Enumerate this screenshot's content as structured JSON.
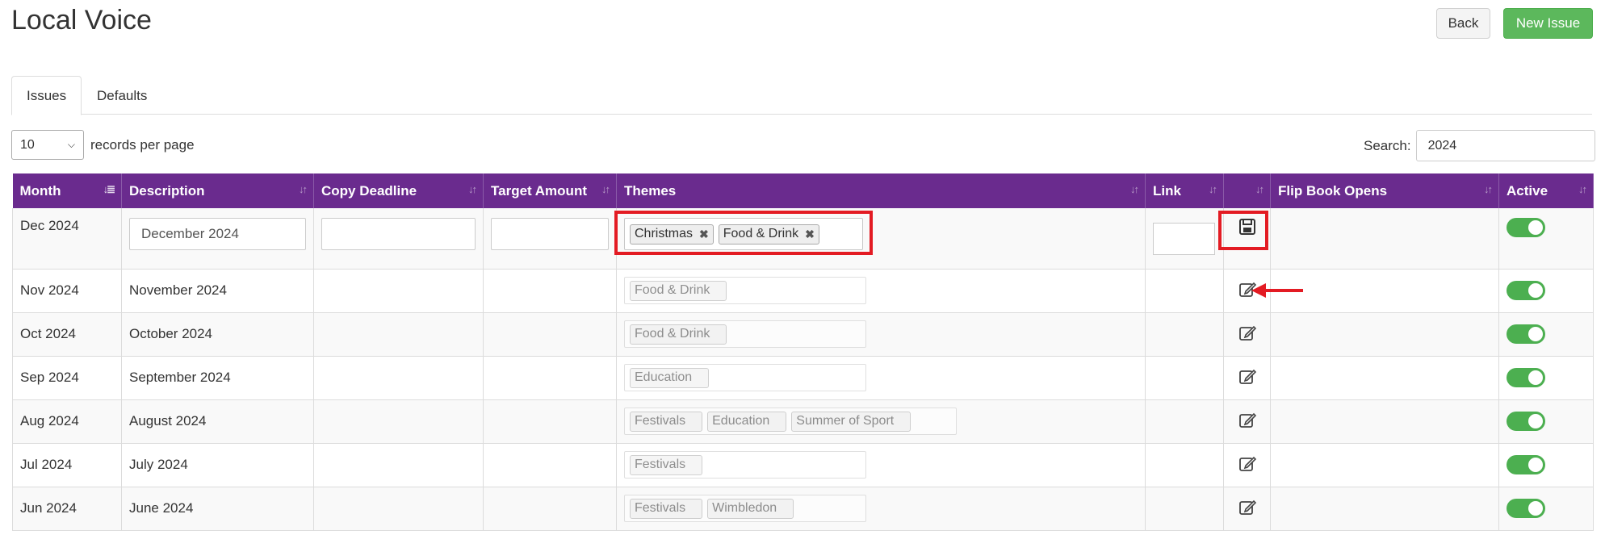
{
  "header": {
    "title": "Local Voice",
    "back_label": "Back",
    "new_issue_label": "New Issue"
  },
  "tabs": [
    {
      "label": "Issues",
      "active": true
    },
    {
      "label": "Defaults",
      "active": false
    }
  ],
  "controls": {
    "page_length": "10",
    "page_length_suffix": "records per page",
    "search_label": "Search:",
    "search_value": "2024"
  },
  "columns": [
    "Month",
    "Description",
    "Copy Deadline",
    "Target Amount",
    "Themes",
    "Link",
    "",
    "Flip Book Opens",
    "Active"
  ],
  "edit_row": {
    "month": "Dec 2024",
    "description": "December 2024",
    "copy_deadline": "",
    "target_amount": "",
    "themes": [
      "Christmas",
      "Food & Drink"
    ],
    "link": "",
    "action_icon": "save-icon",
    "active": true
  },
  "rows": [
    {
      "month": "Nov 2024",
      "description": "November 2024",
      "themes": [
        "Food & Drink"
      ],
      "active": true
    },
    {
      "month": "Oct 2024",
      "description": "October 2024",
      "themes": [
        "Food & Drink"
      ],
      "active": true
    },
    {
      "month": "Sep 2024",
      "description": "September 2024",
      "themes": [
        "Education"
      ],
      "active": true
    },
    {
      "month": "Aug 2024",
      "description": "August 2024",
      "themes": [
        "Festivals",
        "Education",
        "Summer of Sport"
      ],
      "active": true
    },
    {
      "month": "Jul 2024",
      "description": "July 2024",
      "themes": [
        "Festivals"
      ],
      "active": true
    },
    {
      "month": "Jun 2024",
      "description": "June 2024",
      "themes": [
        "Festivals",
        "Wimbledon"
      ],
      "active": true
    }
  ],
  "colors": {
    "header_bg": "#6a2b8e",
    "new_issue_bg": "#5cb85c",
    "toggle_on": "#4caf50",
    "annotation": "#e31b23"
  }
}
